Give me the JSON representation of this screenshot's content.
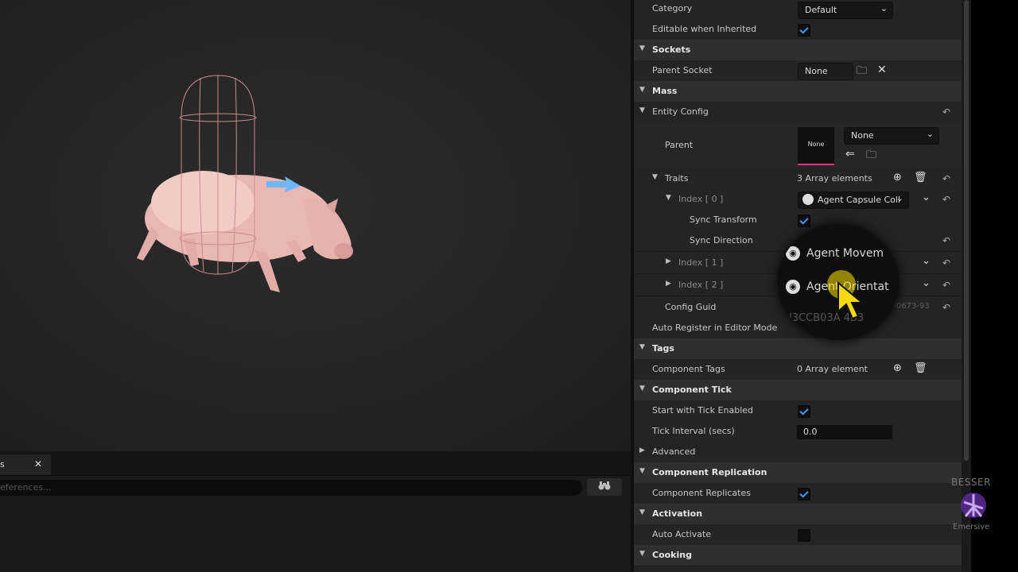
{
  "colors": {
    "accent": "#3b9cff",
    "thumb_underline": "#d63384",
    "cursor": "#f5d90a",
    "watermark": "#7b3fbf"
  },
  "bottom_panel": {
    "tab_label": "s",
    "close_glyph": "✕",
    "search_placeholder": "eferences..."
  },
  "details": {
    "category": {
      "label": "Category",
      "value": "Default"
    },
    "editable_when_inherited": {
      "label": "Editable when Inherited",
      "checked": true
    },
    "sockets": {
      "header": "Sockets",
      "parent_socket": {
        "label": "Parent Socket",
        "value": "None"
      }
    },
    "mass": {
      "header": "Mass",
      "entity_config": {
        "label": "Entity Config"
      },
      "parent": {
        "label": "Parent",
        "thumbnail_text": "None",
        "value": "None"
      },
      "traits": {
        "label": "Traits",
        "count": "3 Array elements"
      },
      "index0": {
        "label": "Index [ 0 ]",
        "value": "Agent Capsule Coll"
      },
      "sync_transform": {
        "label": "Sync Transform",
        "checked": true
      },
      "sync_direction": {
        "label": "Sync Direction"
      },
      "index1": {
        "label": "Index [ 1 ]"
      },
      "index2": {
        "label": "Index [ 2 ]"
      },
      "config_guid": {
        "label": "Config Guid",
        "value_fragment": "4-0673-93"
      },
      "auto_register": {
        "label": "Auto Register in Editor Mode"
      }
    },
    "tags": {
      "header": "Tags",
      "component_tags": {
        "label": "Component Tags",
        "count": "0 Array element"
      }
    },
    "component_tick": {
      "header": "Component Tick",
      "start_with_tick": {
        "label": "Start with Tick Enabled",
        "checked": true
      },
      "tick_interval": {
        "label": "Tick Interval (secs)",
        "value": "0.0"
      },
      "advanced": {
        "label": "Advanced"
      }
    },
    "replication": {
      "header": "Component Replication",
      "replicates": {
        "label": "Component Replicates",
        "checked": true
      }
    },
    "activation": {
      "header": "Activation",
      "auto_activate": {
        "label": "Auto Activate",
        "checked": false
      }
    },
    "cooking": {
      "header": "Cooking"
    }
  },
  "magnifier": {
    "item1": "Agent Movem",
    "item2": "Agent Orientat",
    "guid": "I3CCB03A 4B3"
  },
  "watermark": {
    "top": "BESSER",
    "bottom": "Emersive"
  }
}
